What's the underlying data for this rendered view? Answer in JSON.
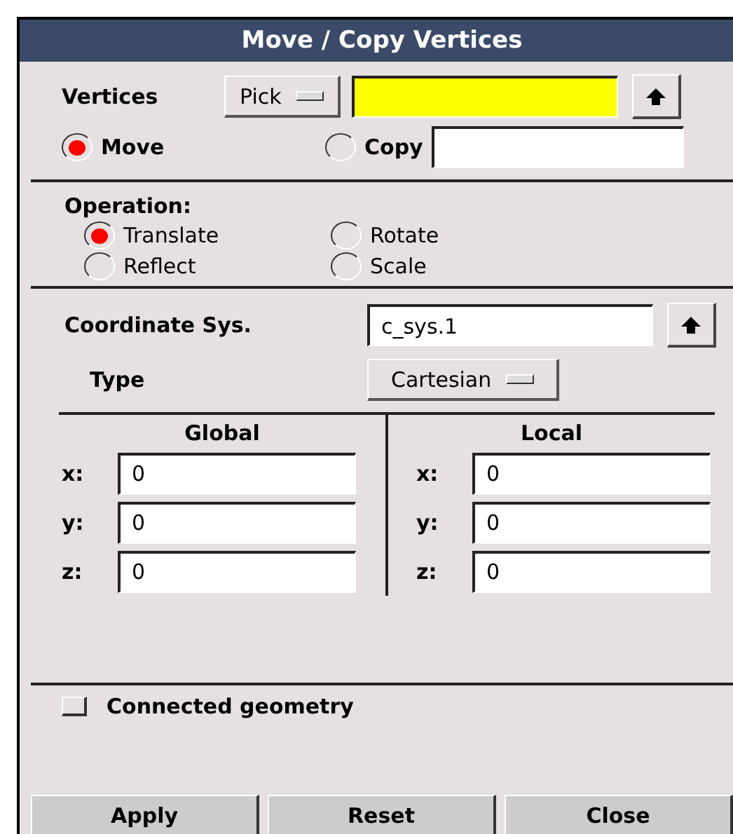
{
  "window": {
    "title": "Move / Copy Vertices"
  },
  "vertices": {
    "label": "Vertices",
    "mode": "Pick"
  },
  "action": [
    {
      "label": "Move",
      "selected": true
    },
    {
      "label": "Copy",
      "selected": false
    }
  ],
  "operation": {
    "label": "Operation:",
    "options": [
      {
        "label": "Translate",
        "selected": true
      },
      {
        "label": "Rotate",
        "selected": false
      },
      {
        "label": "Reflect",
        "selected": false
      },
      {
        "label": "Scale",
        "selected": false
      }
    ]
  },
  "coordinate_sys": {
    "label": "Coordinate Sys.",
    "value": "c_sys.1"
  },
  "type": {
    "label": "Type",
    "value": "Cartesian"
  },
  "columns": [
    {
      "heading": "Global",
      "rows": [
        {
          "axis": "x:",
          "value": "0"
        },
        {
          "axis": "y:",
          "value": "0"
        },
        {
          "axis": "z:",
          "value": "0"
        }
      ]
    },
    {
      "heading": "Local",
      "rows": [
        {
          "axis": "x:",
          "value": "0"
        },
        {
          "axis": "y:",
          "value": "0"
        },
        {
          "axis": "z:",
          "value": "0"
        }
      ]
    }
  ],
  "connected_geometry": {
    "label": "Connected geometry",
    "checked": false
  },
  "buttons": [
    "Apply",
    "Reset",
    "Close"
  ]
}
